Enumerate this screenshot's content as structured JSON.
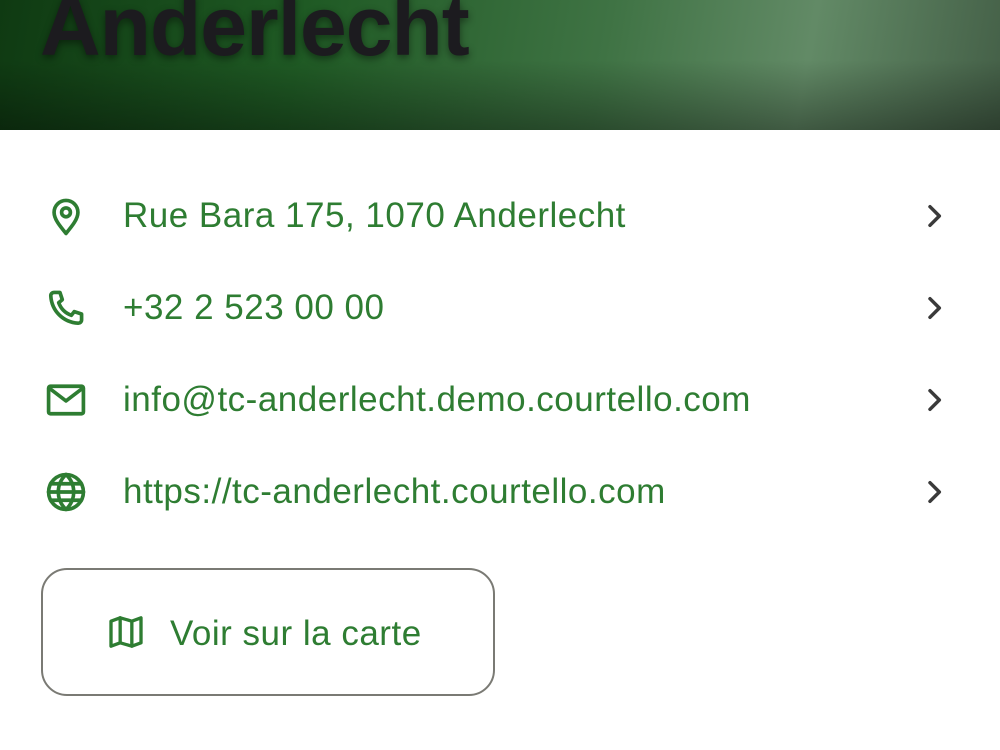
{
  "header": {
    "title": "Anderlecht"
  },
  "contacts": [
    {
      "icon": "location-pin-icon",
      "text": "Rue Bara 175, 1070 Anderlecht"
    },
    {
      "icon": "phone-icon",
      "text": "+32 2 523 00 00"
    },
    {
      "icon": "mail-icon",
      "text": "info@tc-anderlecht.demo.courtello.com"
    },
    {
      "icon": "globe-icon",
      "text": "https://tc-anderlecht.courtello.com"
    }
  ],
  "map_button": {
    "icon": "map-icon",
    "label": "Voir sur la carte"
  },
  "colors": {
    "accent": "#2e7d32",
    "chevron": "#3a3a3a",
    "button_border": "#7a7a74"
  }
}
